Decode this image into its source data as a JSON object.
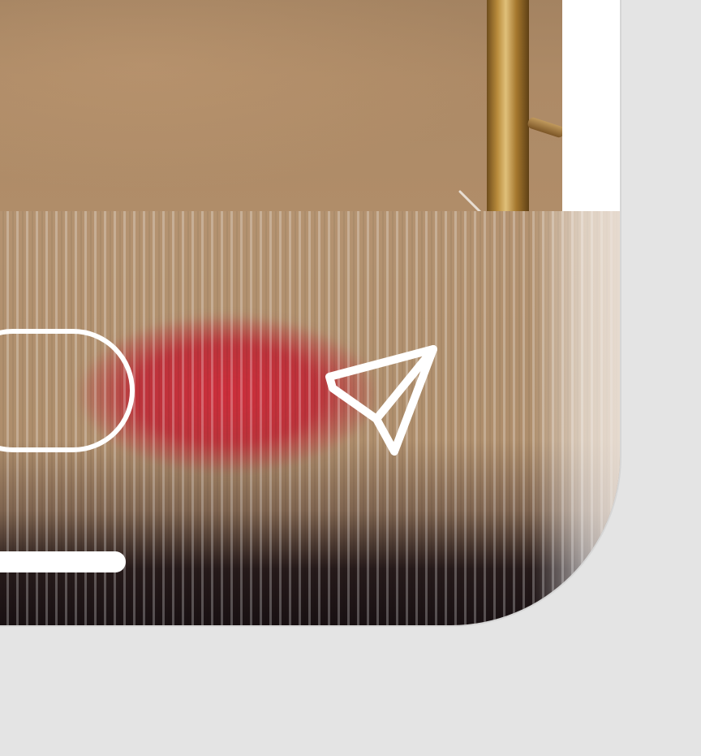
{
  "app": {
    "screen": "story-viewer-reply-bar"
  },
  "reply_bar": {
    "message_placeholder": "",
    "message_value": "",
    "send_icon": "send-paper-plane-icon"
  },
  "system": {
    "home_indicator_icon": "home-indicator"
  },
  "colors": {
    "background": "#e4e4e4",
    "icon_stroke": "#ffffff",
    "media_tone": "#ad8a66",
    "accent_red": "#ce2838"
  }
}
